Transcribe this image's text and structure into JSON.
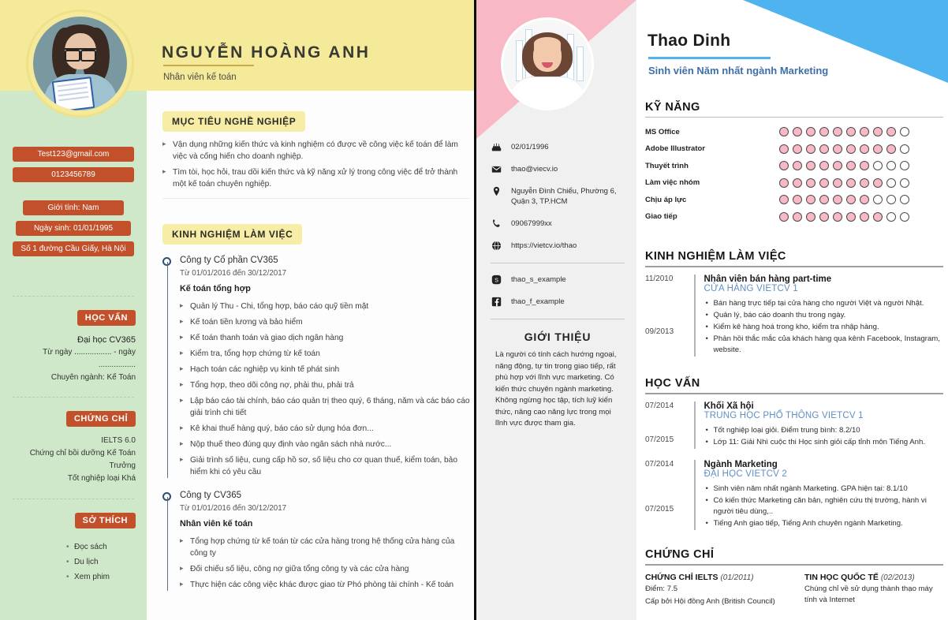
{
  "cv1": {
    "name": "NGUYỄN HOÀNG ANH",
    "job_title": "Nhân viên kế toán",
    "contact_pills": [
      "Test123@gmail.com",
      "0123456789",
      "Giới tính: Nam",
      "Ngày sinh: 01/01/1995",
      "Số 1 đường Cầu Giấy, Hà Nội"
    ],
    "education": {
      "heading": "HỌC VẤN",
      "school": "Đại học CV365",
      "dates": "Từ ngày ................. - ngày .................",
      "major": "Chuyên ngành: Kế Toán"
    },
    "certificates": {
      "heading": "CHỨNG CHỈ",
      "lines": [
        "IELTS 6.0",
        "Chứng chỉ bồi dưỡng Kế Toán Trưởng",
        "Tốt nghiệp loại Khá"
      ]
    },
    "hobbies": {
      "heading": "SỞ THÍCH",
      "items": [
        "Đọc sách",
        "Du lịch",
        "Xem phim"
      ]
    },
    "objective": {
      "heading": "MỤC TIÊU NGHỀ NGHIỆP",
      "bullets": [
        "Vận dụng những kiến thức và kinh nghiệm có được về công việc kế toán để làm việc và cống hiến cho doanh nghiệp.",
        "Tìm tòi, học hỏi, trau dồi kiến thức và kỹ năng xử lý trong công việc để trở thành một kế toán chuyên nghiệp."
      ]
    },
    "experience": {
      "heading": "KINH NGHIỆM LÀM VIỆC",
      "jobs": [
        {
          "company": "Công ty Cổ phần CV365",
          "dates": "Từ 01/01/2016 đến 30/12/2017",
          "role": "Kế toán tổng hợp",
          "bullets": [
            "Quản lý Thu - Chi, tổng hợp, báo cáo quỹ tiền mặt",
            "Kế toán tiền lương và bảo hiểm",
            "Kế toán thanh toán và giao dịch ngân hàng",
            "Kiểm tra, tổng hợp chứng từ kế toán",
            "Hạch toán các nghiệp vụ kinh tế phát sinh",
            "Tổng hợp, theo dõi công nợ, phải thu, phải trả",
            "Lập báo cáo tài chính, báo cáo quản trị theo quý, 6 tháng, năm và các báo cáo giải trình chi tiết",
            "Kê khai thuế hàng quý, báo cáo sử dụng hóa đơn...",
            "Nộp thuế theo đúng quy định vào ngân sách nhà nước...",
            "Giải trình số liệu, cung cấp hồ sơ, số liệu cho cơ quan thuế, kiểm toán, bảo hiểm khi có yêu cầu"
          ]
        },
        {
          "company": "Công ty CV365",
          "dates": "Từ 01/01/2016 đến 30/12/2017",
          "role": "Nhân viên kế toán",
          "bullets": [
            "Tổng hợp chứng từ kế toán từ các cửa hàng trong hệ thống cửa hàng của công ty",
            "Đối chiếu số liệu, công nợ giữa tổng công ty và các cửa hàng",
            "Thực hiện các công việc khác được giao từ Phó phòng tài chính - Kế toán"
          ]
        }
      ]
    }
  },
  "cv2": {
    "name": "Thao Dinh",
    "subtitle": "Sinh viên Năm nhất ngành Marketing",
    "contacts": [
      {
        "icon": "cake-icon",
        "text": "02/01/1996"
      },
      {
        "icon": "envelope-icon",
        "text": "thao@viecv.io"
      },
      {
        "icon": "map-pin-icon",
        "text": "Nguyễn Đình Chiểu, Phường 6, Quận 3, TP.HCM"
      },
      {
        "icon": "phone-icon",
        "text": "09067999xx"
      },
      {
        "icon": "globe-icon",
        "text": "https://vietcv.io/thao"
      }
    ],
    "socials": [
      {
        "icon": "skype-icon",
        "text": "thao_s_example"
      },
      {
        "icon": "facebook-icon",
        "text": "thao_f_example"
      }
    ],
    "intro": {
      "heading": "GIỚI THIỆU",
      "body": "Là người có tính cách hướng ngoại, năng động, tự tin trong giao tiếp, rất phù hợp với lĩnh vực marketing. Có kiến thức chuyên ngành marketing. Không ngừng học tập, tích luỹ kiến thức, nâng cao năng lực trong mọi lĩnh vực được tham gia."
    },
    "skills": {
      "heading": "KỸ NĂNG",
      "max": 10,
      "items": [
        {
          "name": "MS Office",
          "level": 9
        },
        {
          "name": "Adobe Illustrator",
          "level": 9
        },
        {
          "name": "Thuyết trình",
          "level": 7
        },
        {
          "name": "Làm việc nhóm",
          "level": 8
        },
        {
          "name": "Chịu áp lực",
          "level": 7
        },
        {
          "name": "Giao tiếp",
          "level": 8
        }
      ]
    },
    "experience": {
      "heading": "KINH NGHIỆM LÀM VIỆC",
      "entries": [
        {
          "date_start": "11/2010",
          "date_end": "09/2013",
          "role": "Nhân viên bán hàng part-time",
          "org": "CỬA HÀNG VIETCV 1",
          "bullets": [
            "Bán hàng trực tiếp tại cửa hàng cho người Việt và người Nhật.",
            "Quản lý, báo cáo doanh thu trong ngày.",
            "Kiểm kê hàng hoá trong kho, kiểm tra nhập hàng.",
            "Phản hồi thắc mắc của khách hàng qua kênh Facebook, Instagram, website."
          ]
        }
      ]
    },
    "education": {
      "heading": "HỌC VẤN",
      "entries": [
        {
          "date_start": "07/2014",
          "date_end": "07/2015",
          "role": "Khối Xã hội",
          "org": "TRUNG HỌC PHỔ THÔNG VIETCV 1",
          "bullets": [
            "Tốt nghiệp loại giỏi. Điểm trung bình: 8.2/10",
            "Lớp 11: Giải Nhì cuộc thi Học sinh giỏi cấp tỉnh môn Tiếng Anh."
          ]
        },
        {
          "date_start": "07/2014",
          "date_end": "07/2015",
          "role": "Ngành Marketing",
          "org": "ĐẠI HỌC VIETCV 2",
          "bullets": [
            "Sinh viên năm nhất ngành Marketing. GPA hiện tại: 8.1/10",
            "Có kiến thức Marketing căn bản, nghiên cứu thị trường, hành vi người tiêu dùng,..",
            "Tiếng Anh giao tiếp, Tiếng Anh chuyên ngành Marketing."
          ]
        }
      ]
    },
    "certificates": {
      "heading": "CHỨNG CHỈ",
      "items": [
        {
          "title": "CHỨNG CHỈ IELTS",
          "date": "(01/2011)",
          "lines": [
            "Điểm: 7.5",
            "Cấp bởi Hội đồng Anh (British Council)"
          ]
        },
        {
          "title": "TIN HỌC QUỐC TẾ",
          "date": "(02/2013)",
          "lines": [
            "Chúng chỉ về sử dụng thành thạo máy tính và Internet"
          ]
        }
      ]
    }
  },
  "colors": {
    "cv1_yellow": "#f5ea9a",
    "cv1_green": "#cfe8c9",
    "cv1_red": "#c2512b",
    "cv2_pink": "#f9b8c6",
    "cv2_blue": "#4fb3f0",
    "cv2_link_blue": "#5f8fc4"
  }
}
